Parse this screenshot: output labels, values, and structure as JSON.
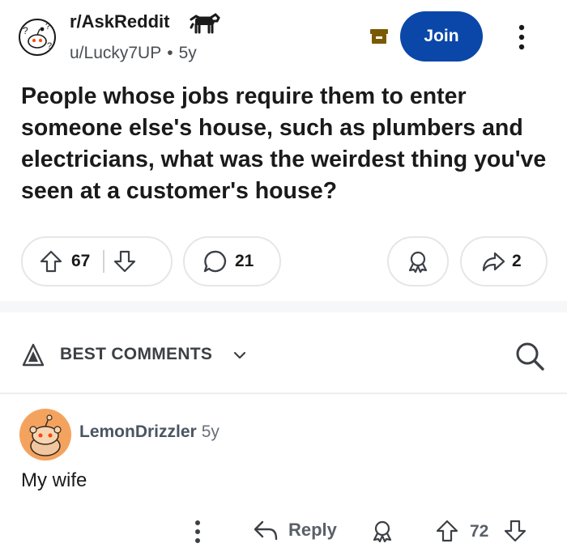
{
  "header": {
    "subreddit": "r/AskReddit",
    "username": "u/Lucky7UP",
    "age": "5y",
    "join_label": "Join"
  },
  "post": {
    "title": "People whose jobs require them to enter someone else's house, such as plumbers and electricians, what was the weirdest thing you've seen at a customer's house?",
    "upvotes": "67",
    "comments": "21",
    "shares": "2"
  },
  "comments_section": {
    "sort_label": "BEST COMMENTS"
  },
  "comment": {
    "username": "LemonDrizzler",
    "age": "5y",
    "body": "My wife",
    "reply_label": "Reply",
    "score": "72"
  },
  "colors": {
    "join_button": "#0a47a9",
    "avatar_orange": "#f4a35f"
  }
}
